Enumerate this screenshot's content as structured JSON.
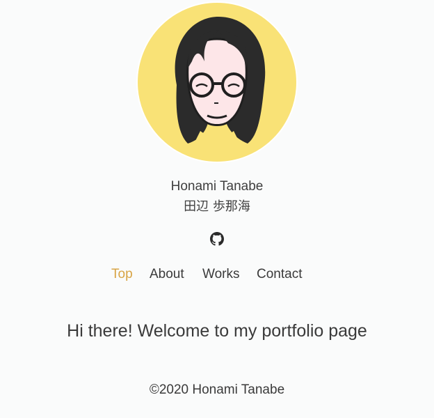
{
  "profile": {
    "name_en": "Honami Tanabe",
    "name_ja": "田辺 歩那海",
    "avatar_icon": "portrait-illustration",
    "avatar_bg_color": "#f9e276"
  },
  "social": {
    "github_icon": "github-icon"
  },
  "nav": {
    "items": [
      {
        "label": "Top",
        "active": true
      },
      {
        "label": "About",
        "active": false
      },
      {
        "label": "Works",
        "active": false
      },
      {
        "label": "Contact",
        "active": false
      }
    ],
    "active_color": "#d8a445"
  },
  "main": {
    "welcome": "Hi there! Welcome to my portfolio page"
  },
  "footer": {
    "copyright": "©2020 Honami Tanabe"
  }
}
